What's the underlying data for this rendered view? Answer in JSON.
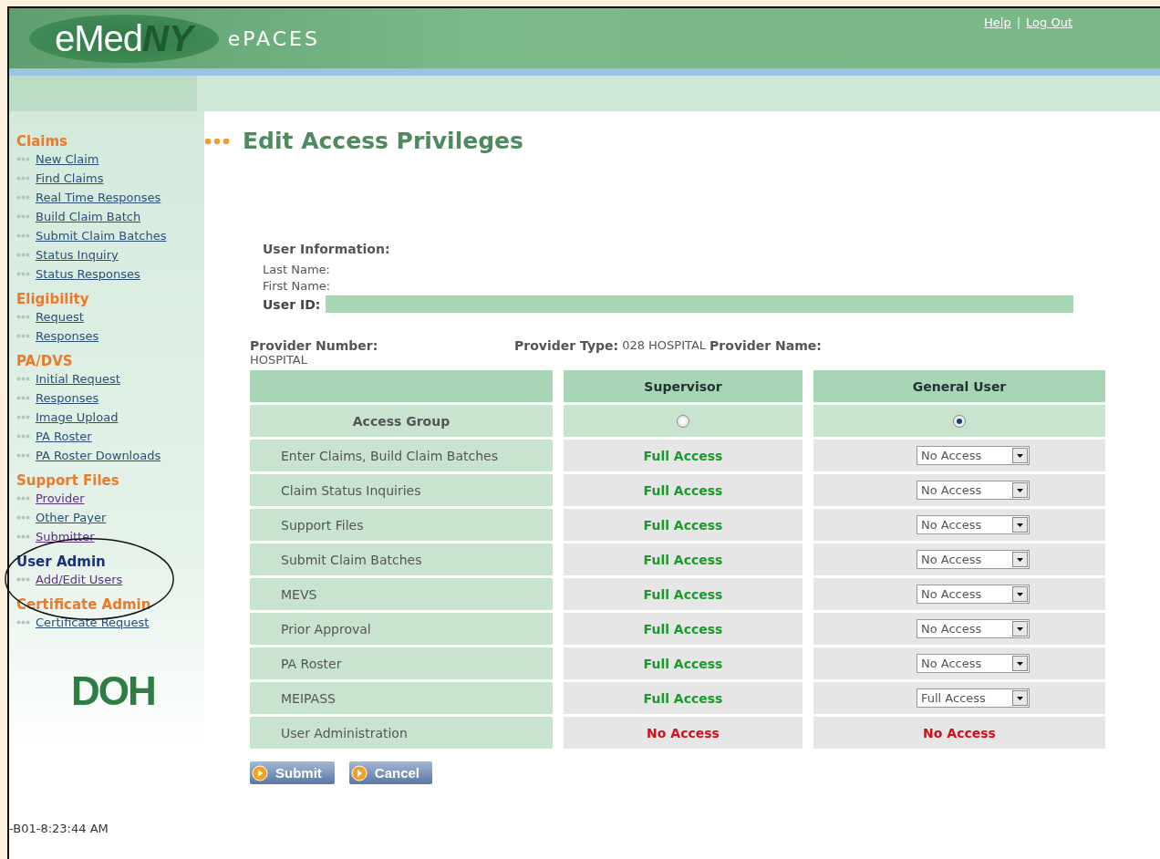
{
  "header": {
    "logo": {
      "main": "eMed",
      "accent": "NY",
      "product": "ePACES"
    },
    "links": [
      {
        "label": "Help"
      },
      {
        "label": "Log Out"
      }
    ],
    "separator": "|"
  },
  "sidebar": {
    "sections": [
      {
        "title": "Claims",
        "selected": false,
        "links": [
          {
            "label": "New Claim",
            "visited": false
          },
          {
            "label": "Find Claims",
            "visited": false
          },
          {
            "label": "Real Time Responses",
            "visited": false
          },
          {
            "label": "Build Claim Batch",
            "visited": false
          },
          {
            "label": "Submit Claim Batches",
            "visited": false
          },
          {
            "label": "Status Inquiry",
            "visited": false
          },
          {
            "label": "Status Responses",
            "visited": false
          }
        ]
      },
      {
        "title": "Eligibility",
        "selected": false,
        "links": [
          {
            "label": "Request",
            "visited": false
          },
          {
            "label": "Responses",
            "visited": false
          }
        ]
      },
      {
        "title": "PA/DVS",
        "selected": false,
        "links": [
          {
            "label": "Initial Request",
            "visited": false
          },
          {
            "label": "Responses",
            "visited": false
          },
          {
            "label": "Image Upload",
            "visited": false
          },
          {
            "label": "PA Roster",
            "visited": false
          },
          {
            "label": "PA Roster Downloads",
            "visited": false
          }
        ]
      },
      {
        "title": "Support Files",
        "selected": false,
        "links": [
          {
            "label": "Provider",
            "visited": true
          },
          {
            "label": "Other Payer",
            "visited": false
          },
          {
            "label": "Submitter",
            "visited": true
          }
        ]
      },
      {
        "title": "User Admin",
        "selected": true,
        "links": [
          {
            "label": "Add/Edit Users",
            "visited": true
          }
        ]
      },
      {
        "title": "Certificate Admin",
        "selected": false,
        "links": [
          {
            "label": "Certificate Request",
            "visited": false
          }
        ]
      }
    ],
    "logo": "DOH",
    "footer": "-B01-8:23:44 AM"
  },
  "page": {
    "title": "Edit Access Privileges",
    "user_info": {
      "heading": "User Information:",
      "last_name_label": "Last Name:",
      "first_name_label": "First Name:",
      "user_id_label": "User ID:"
    },
    "provider": {
      "number_label": "Provider Number:",
      "number_value": "HOSPITAL",
      "type_label": "Provider Type:",
      "type_value": "028 HOSPITAL",
      "name_label": "Provider Name:"
    },
    "table": {
      "columns": [
        "Supervisor",
        "General User"
      ],
      "group_label": "Access Group",
      "roles": [
        {
          "selected": false
        },
        {
          "selected": true
        }
      ],
      "rows": [
        {
          "name": "Enter Claims, Build Claim Batches",
          "supervisor": {
            "kind": "granted",
            "text": "Full Access"
          },
          "general": {
            "kind": "select",
            "text": "No Access"
          }
        },
        {
          "name": "Claim Status Inquiries",
          "supervisor": {
            "kind": "granted",
            "text": "Full Access"
          },
          "general": {
            "kind": "select",
            "text": "No Access"
          }
        },
        {
          "name": "Support Files",
          "supervisor": {
            "kind": "granted",
            "text": "Full Access"
          },
          "general": {
            "kind": "select",
            "text": "No Access"
          }
        },
        {
          "name": "Submit Claim Batches",
          "supervisor": {
            "kind": "granted",
            "text": "Full Access"
          },
          "general": {
            "kind": "select",
            "text": "No Access"
          }
        },
        {
          "name": "MEVS",
          "supervisor": {
            "kind": "granted",
            "text": "Full Access"
          },
          "general": {
            "kind": "select",
            "text": "No Access"
          }
        },
        {
          "name": "Prior Approval",
          "supervisor": {
            "kind": "granted",
            "text": "Full Access"
          },
          "general": {
            "kind": "select",
            "text": "No Access"
          }
        },
        {
          "name": "PA Roster",
          "supervisor": {
            "kind": "granted",
            "text": "Full Access"
          },
          "general": {
            "kind": "select",
            "text": "No Access"
          }
        },
        {
          "name": "MEIPASS",
          "supervisor": {
            "kind": "granted",
            "text": "Full Access"
          },
          "general": {
            "kind": "select",
            "text": "Full Access"
          }
        },
        {
          "name": "User Administration",
          "supervisor": {
            "kind": "denied",
            "text": "No Access"
          },
          "general": {
            "kind": "denied",
            "text": "No Access"
          }
        }
      ]
    },
    "buttons": [
      {
        "label": "Submit"
      },
      {
        "label": "Cancel"
      }
    ]
  }
}
